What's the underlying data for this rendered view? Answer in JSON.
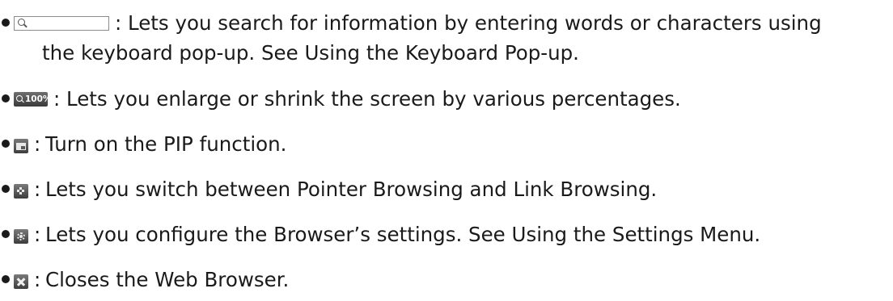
{
  "items": [
    {
      "icon": "search-field-icon",
      "colon": ":",
      "text": "Lets you search for information by entering words or characters using",
      "continuation": "the keyboard pop-up. See Using the Keyboard Pop-up."
    },
    {
      "icon": "zoom-icon",
      "icon_label": "100%",
      "colon": ":",
      "text": "Lets you enlarge or shrink the screen by various percentages."
    },
    {
      "icon": "pip-icon",
      "colon": ":",
      "text": "Turn on the PIP function."
    },
    {
      "icon": "pointer-browsing-icon",
      "colon": ":",
      "text": "Lets you switch between Pointer Browsing and Link Browsing."
    },
    {
      "icon": "settings-gear-icon",
      "colon": ":",
      "text": "Lets you configure the Browser’s settings. See Using the Settings Menu."
    },
    {
      "icon": "close-icon",
      "colon": ":",
      "text": "Closes the Web Browser."
    }
  ]
}
